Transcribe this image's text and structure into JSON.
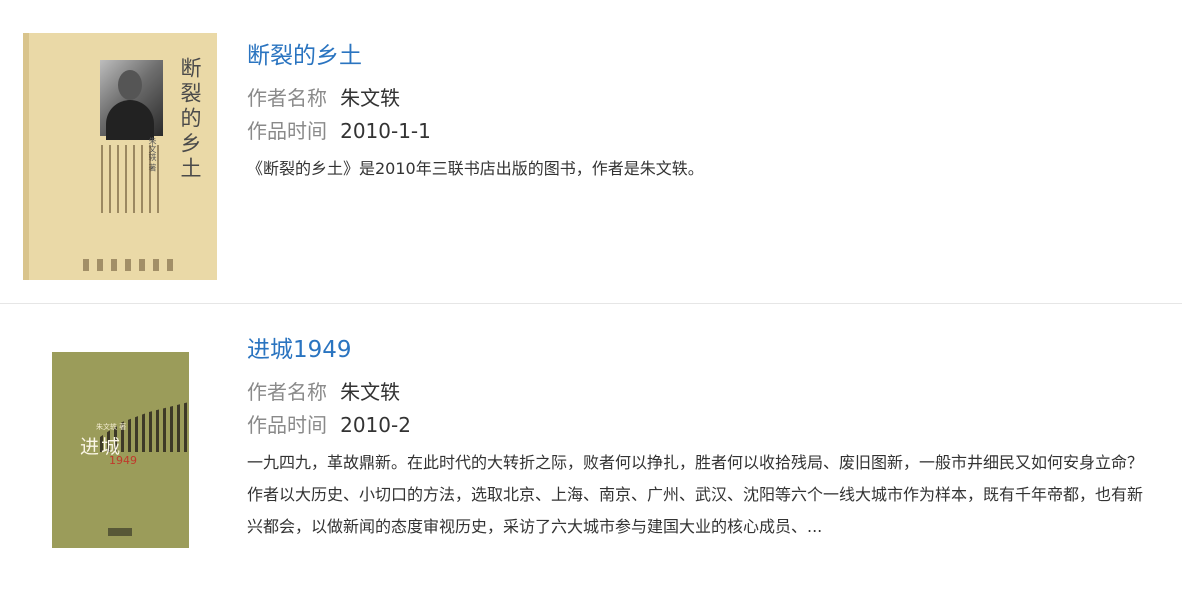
{
  "books": [
    {
      "title": "断裂的乡土",
      "author_label": "作者名称",
      "author": "朱文轶",
      "date_label": "作品时间",
      "date": "2010-1-1",
      "description": "《断裂的乡土》是2010年三联书店出版的图书，作者是朱文轶。"
    },
    {
      "title": "进城1949",
      "author_label": "作者名称",
      "author": "朱文轶",
      "date_label": "作品时间",
      "date": "2010-2",
      "description": "一九四九，革故鼎新。在此时代的大转折之际，败者何以挣扎，胜者何以收拾残局、废旧图新，一般市井细民又如何安身立命？作者以大历史、小切口的方法，选取北京、上海、南京、广州、武汉、沈阳等六个一线大城市作为样本，既有千年帝都，也有新兴都会，以做新闻的态度审视历史，采访了六大城市参与建国大业的核心成员、..."
    }
  ],
  "covers": {
    "book1": {
      "title": "断裂的乡土",
      "author_line": "朱文轶 著"
    },
    "book2": {
      "title": "进城",
      "year": "1949",
      "author_line": "朱文轶 著"
    }
  },
  "colors": {
    "title_link": "#2a74c0",
    "label": "#8a8a8a",
    "value": "#333333",
    "divider": "#e6e6e6"
  }
}
